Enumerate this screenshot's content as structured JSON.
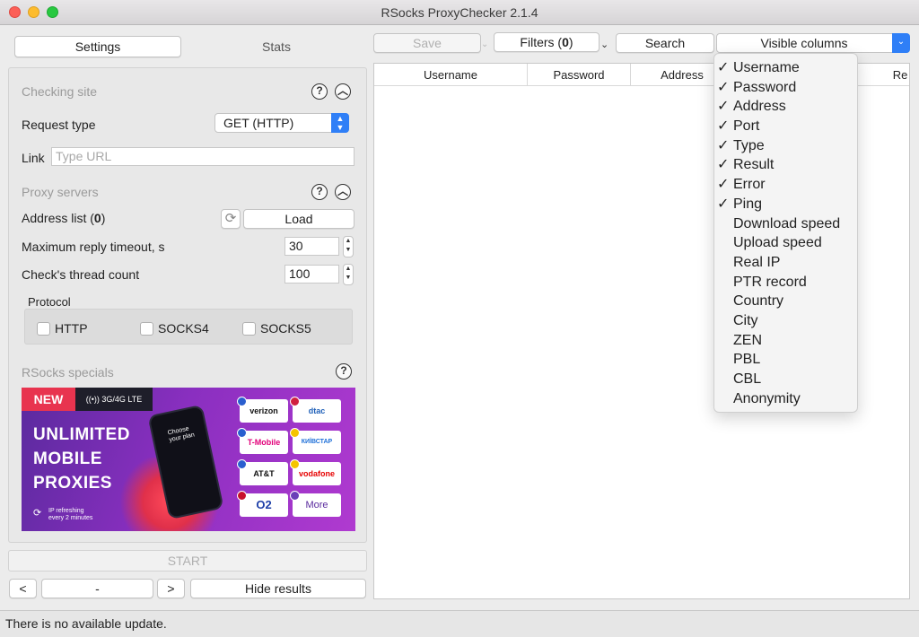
{
  "window": {
    "title": "RSocks ProxyChecker 2.1.4"
  },
  "tabs": {
    "settings": "Settings",
    "stats": "Stats"
  },
  "checking_site": {
    "title": "Checking site",
    "request_type_label": "Request type",
    "request_type_value": "GET (HTTP)",
    "link_label": "Link",
    "link_placeholder": "Type URL"
  },
  "proxy_servers": {
    "title": "Proxy servers",
    "address_list_label": "Address list (",
    "address_list_count": "0",
    "address_list_suffix": ")",
    "load_label": "Load",
    "timeout_label": "Maximum reply timeout, s",
    "timeout_value": "30",
    "threads_label": "Check's thread count",
    "threads_value": "100"
  },
  "protocol": {
    "title": "Protocol",
    "options": [
      {
        "label": "HTTP",
        "checked": false
      },
      {
        "label": "SOCKS4",
        "checked": false
      },
      {
        "label": "SOCKS5",
        "checked": false
      }
    ]
  },
  "specials": {
    "title": "RSocks specials",
    "banner": {
      "new": "NEW",
      "lte": "3G/4G LTE",
      "line1": "UNLIMITED",
      "line2": "MOBILE",
      "line3": "PROXIES",
      "refresh_line1": "IP refreshing",
      "refresh_line2": "every 2 minutes",
      "phone_text": "Choose your plan",
      "operators": [
        "verizon",
        "dtac",
        "T-Mobile",
        "КИЇВСТАР",
        "AT&T",
        "vodafone",
        "O2",
        "More"
      ]
    }
  },
  "controls": {
    "start": "START",
    "prev": "<",
    "page": "-",
    "next": ">",
    "hide_results": "Hide results"
  },
  "toolbar": {
    "save": "Save",
    "filters_label": "Filters (",
    "filters_count": "0",
    "filters_suffix": ")",
    "search": "Search",
    "visible_columns": "Visible columns"
  },
  "table": {
    "headers": [
      "Username",
      "Password",
      "Address",
      "Re"
    ]
  },
  "columns_menu": [
    {
      "label": "Username",
      "checked": true
    },
    {
      "label": "Password",
      "checked": true
    },
    {
      "label": "Address",
      "checked": true
    },
    {
      "label": "Port",
      "checked": true
    },
    {
      "label": "Type",
      "checked": true
    },
    {
      "label": "Result",
      "checked": true
    },
    {
      "label": "Error",
      "checked": true
    },
    {
      "label": "Ping",
      "checked": true
    },
    {
      "label": "Download speed",
      "checked": false
    },
    {
      "label": "Upload speed",
      "checked": false
    },
    {
      "label": "Real IP",
      "checked": false
    },
    {
      "label": "PTR record",
      "checked": false
    },
    {
      "label": "Country",
      "checked": false
    },
    {
      "label": "City",
      "checked": false
    },
    {
      "label": "ZEN",
      "checked": false
    },
    {
      "label": "PBL",
      "checked": false
    },
    {
      "label": "CBL",
      "checked": false
    },
    {
      "label": "Anonymity",
      "checked": false
    }
  ],
  "status": {
    "text": "There is no available update."
  },
  "colors": {
    "accent": "#2f7ff7",
    "banner_purple": "#8a2fc0",
    "banner_red": "#e8344f"
  },
  "icons": {
    "help": "question-circle-icon",
    "collapse": "chevron-up-circle-icon",
    "refresh": "refresh-icon",
    "check": "checkmark-icon"
  }
}
